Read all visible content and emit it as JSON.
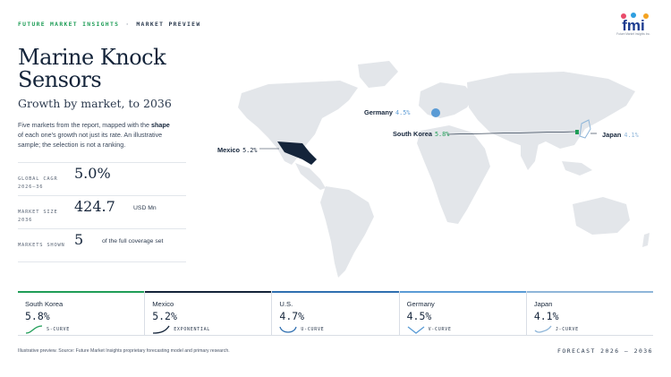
{
  "header": {
    "brand": "FUTURE MARKET INSIGHTS",
    "separator": "·",
    "section": "MARKET PREVIEW",
    "logo_text": "fmi",
    "logo_tagline": "Future Market Insights Inc."
  },
  "title": "Marine Knock Sensors",
  "subtitle": "Growth by market, to 2036",
  "description": {
    "part1": "Five markets from the report, mapped with the ",
    "bold": "shape",
    "part2": " of each one's growth not just its rate. An illustrative sample; the selection is not a ranking."
  },
  "stats": [
    {
      "label": "GLOBAL CAGR 2026–36",
      "value": "5.0%",
      "unit": ""
    },
    {
      "label": "MARKET SIZE 2036",
      "value": "424.7",
      "unit": "USD Mn"
    },
    {
      "label": "MARKETS SHOWN",
      "value": "5",
      "unit": "of the full coverage set"
    }
  ],
  "map_labels": [
    {
      "name": "Germany",
      "value": "4.5%",
      "color": "#5a9bd5"
    },
    {
      "name": "South Korea",
      "value": "5.8%",
      "color": "#1f9d57"
    },
    {
      "name": "Japan",
      "value": "4.1%",
      "color": "#8fb6d9"
    },
    {
      "name": "Mexico",
      "value": "5.2%",
      "color": "#14243a"
    }
  ],
  "cards": [
    {
      "market": "South Korea",
      "cagr": "5.8%",
      "shape": "S-CURVE",
      "color": "#1f9d57"
    },
    {
      "market": "Mexico",
      "cagr": "5.2%",
      "shape": "EXPONENTIAL",
      "color": "#14243a"
    },
    {
      "market": "U.S.",
      "cagr": "4.7%",
      "shape": "U-CURVE",
      "color": "#2f6fb0"
    },
    {
      "market": "Germany",
      "cagr": "4.5%",
      "shape": "V-CURVE",
      "color": "#5a9bd5"
    },
    {
      "market": "Japan",
      "cagr": "4.1%",
      "shape": "J-CURVE",
      "color": "#8fb6d9"
    }
  ],
  "footer": {
    "note": "Illustrative preview. Source: Future Market Insights proprietary forecasting model and primary research.",
    "forecast": "FORECAST 2026 – 2036"
  }
}
